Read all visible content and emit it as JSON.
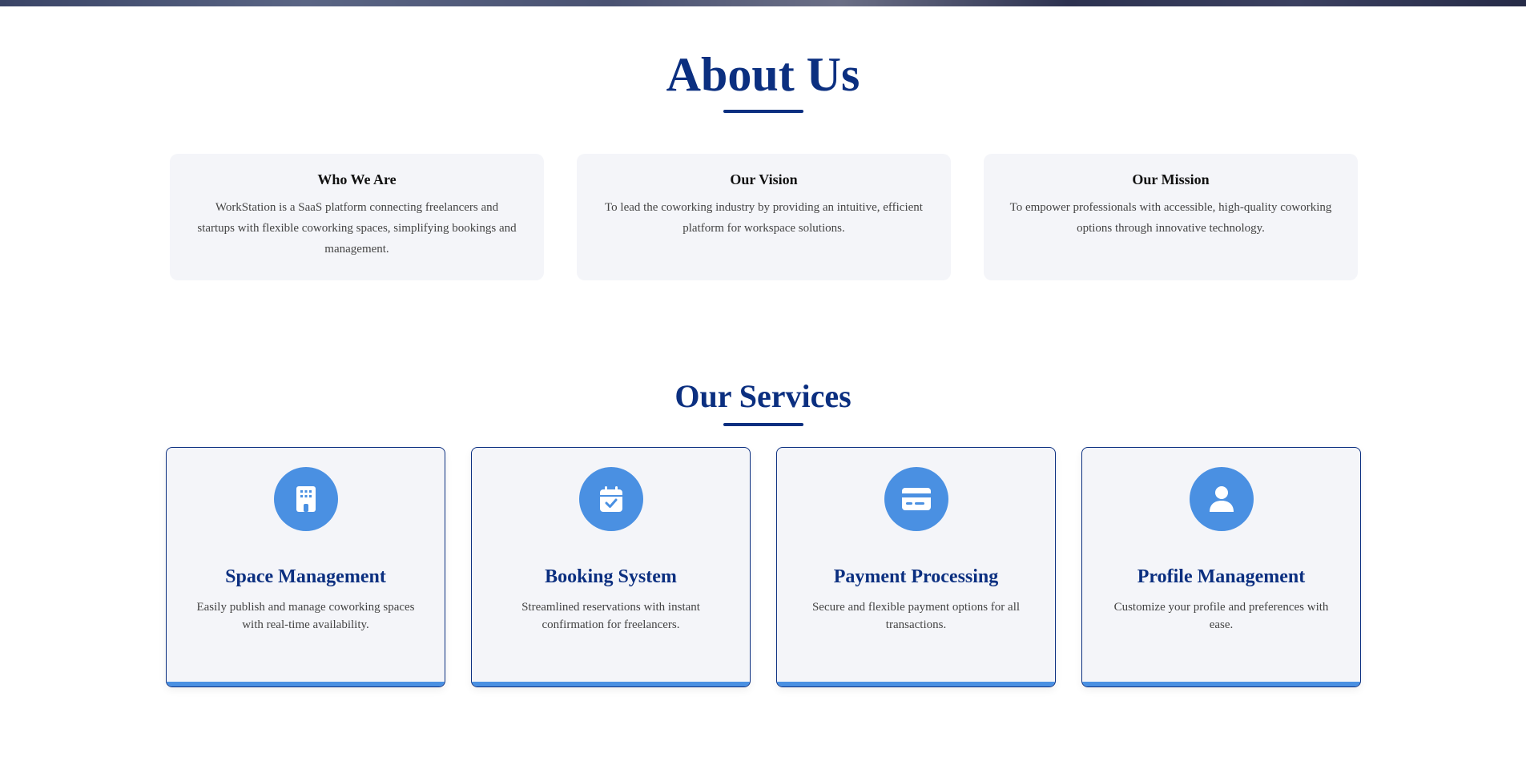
{
  "about": {
    "title": "About Us",
    "cards": [
      {
        "heading": "Who We Are",
        "text": "WorkStation is a SaaS platform connecting freelancers and startups with flexible coworking spaces, simplifying bookings and management."
      },
      {
        "heading": "Our Vision",
        "text": "To lead the coworking industry by providing an intuitive, efficient platform for workspace solutions."
      },
      {
        "heading": "Our Mission",
        "text": "To empower professionals with accessible, high-quality coworking options through innovative technology."
      }
    ]
  },
  "services": {
    "title": "Our Services",
    "cards": [
      {
        "icon": "building-icon",
        "heading": "Space Management",
        "text": "Easily publish and manage coworking spaces with real-time availability."
      },
      {
        "icon": "calendar-check-icon",
        "heading": "Booking System",
        "text": "Streamlined reservations with instant confirmation for freelancers."
      },
      {
        "icon": "credit-card-icon",
        "heading": "Payment Processing",
        "text": "Secure and flexible payment options for all transactions."
      },
      {
        "icon": "user-icon",
        "heading": "Profile Management",
        "text": "Customize your profile and preferences with ease."
      }
    ]
  },
  "colors": {
    "title": "#0b2f80",
    "accent": "#4a90e2",
    "card_bg": "#f4f5f9"
  }
}
